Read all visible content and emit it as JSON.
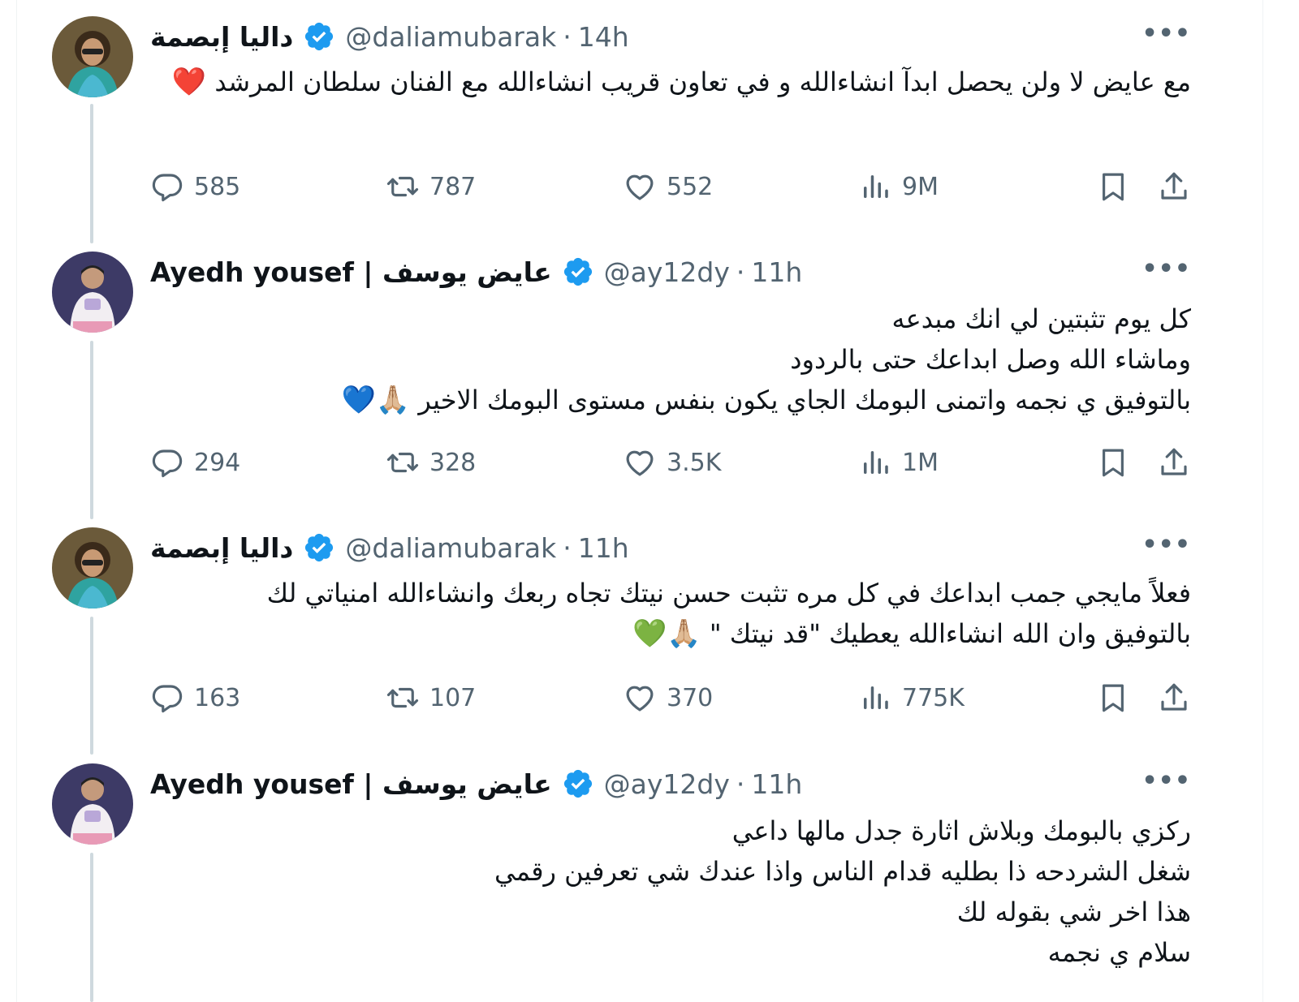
{
  "tweets": [
    {
      "name": "داليا إبصمة",
      "handle": "@daliamubarak",
      "time": "14h",
      "text": "مع عايض لا ولن يحصل ابدآ انشاءالله و في تعاون قريب انشاءالله مع الفنان سلطان المرشد",
      "emoji": "❤️",
      "replies": "585",
      "retweets": "787",
      "likes": "552",
      "views": "9M"
    },
    {
      "name": "Ayedh yousef | عايض يوسف",
      "handle": "@ay12dy",
      "time": "11h",
      "lines": [
        "كل يوم تثبتين لي انك مبدعه",
        "وماشاء الله وصل ابداعك حتى بالردود",
        "بالتوفيق ي نجمه واتمنى البومك الجاي يكون بنفس مستوى البومك الاخير"
      ],
      "emoji": "🙏🏼💙",
      "replies": "294",
      "retweets": "328",
      "likes": "3.5K",
      "views": "1M"
    },
    {
      "name": "داليا إبصمة",
      "handle": "@daliamubarak",
      "time": "11h",
      "lines": [
        "فعلاً مايجي جمب ابداعك في كل مره تثبت حسن نيتك تجاه ربعك وانشاءالله امنياتي لك",
        "بالتوفيق وان الله انشاءالله يعطيك \"قد نيتك \""
      ],
      "emoji": "🙏🏼💚",
      "replies": "163",
      "retweets": "107",
      "likes": "370",
      "views": "775K"
    },
    {
      "name": "Ayedh yousef | عايض يوسف",
      "handle": "@ay12dy",
      "time": "11h",
      "lines": [
        "ركزي بالبومك وبلاش اثارة جدل مالها داعي",
        "شغل الشردحه ذا بطليه قدام الناس واذا عندك شي تعرفين رقمي",
        "هذا اخر شي بقوله لك",
        "سلام ي نجمه"
      ]
    }
  ],
  "icons": {
    "verified": "verified-badge-icon",
    "reply": "reply-icon",
    "retweet": "retweet-icon",
    "like": "heart-icon",
    "views": "views-icon",
    "bookmark": "bookmark-icon",
    "share": "share-icon",
    "more": "more-icon"
  },
  "colors": {
    "verified": "#1d9bf0",
    "meta": "#536471",
    "text": "#0f1419",
    "thread_line": "#cfd9de"
  }
}
